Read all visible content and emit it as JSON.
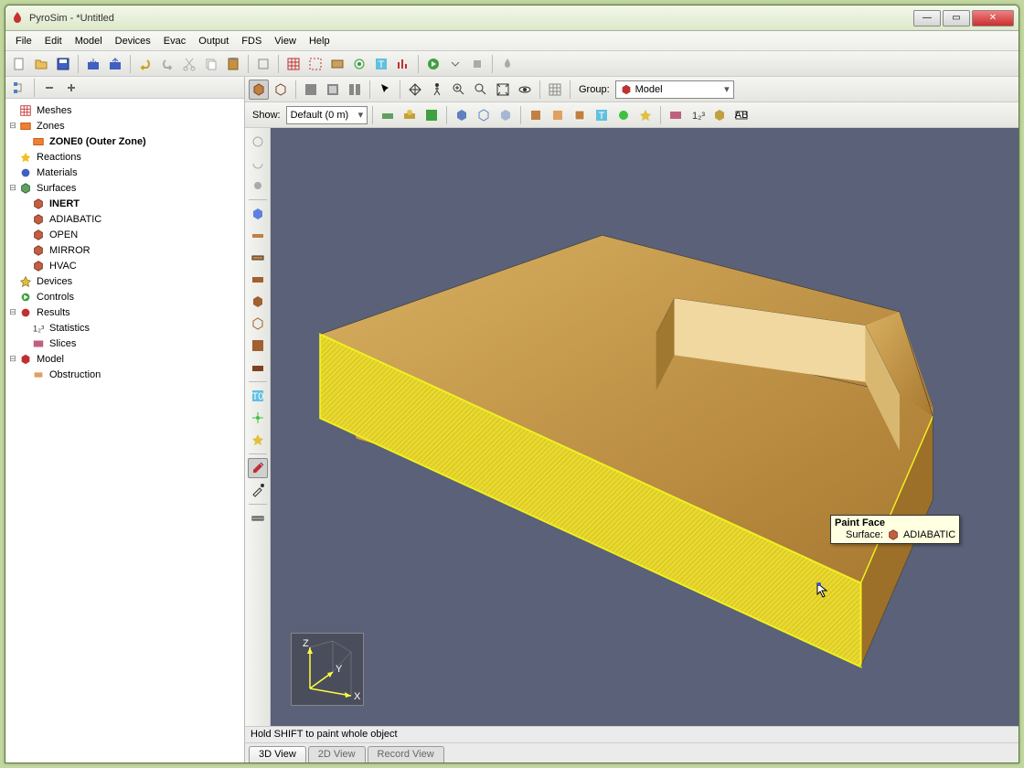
{
  "window": {
    "title": "PyroSim - *Untitled"
  },
  "menu": [
    "File",
    "Edit",
    "Model",
    "Devices",
    "Evac",
    "Output",
    "FDS",
    "View",
    "Help"
  ],
  "sidebar": {
    "items": [
      {
        "label": "Meshes",
        "icon": "mesh",
        "indent": 0,
        "bold": false,
        "toggle": ""
      },
      {
        "label": "Zones",
        "icon": "zone",
        "indent": 0,
        "bold": false,
        "toggle": "⊟"
      },
      {
        "label": "ZONE0 (Outer Zone)",
        "icon": "zone",
        "indent": 1,
        "bold": true,
        "toggle": ""
      },
      {
        "label": "Reactions",
        "icon": "reaction",
        "indent": 0,
        "bold": false,
        "toggle": ""
      },
      {
        "label": "Materials",
        "icon": "material",
        "indent": 0,
        "bold": false,
        "toggle": ""
      },
      {
        "label": "Surfaces",
        "icon": "surface",
        "indent": 0,
        "bold": false,
        "toggle": "⊟"
      },
      {
        "label": "INERT",
        "icon": "surf",
        "indent": 1,
        "bold": true,
        "toggle": ""
      },
      {
        "label": "ADIABATIC",
        "icon": "surf",
        "indent": 1,
        "bold": false,
        "toggle": ""
      },
      {
        "label": "OPEN",
        "icon": "surf",
        "indent": 1,
        "bold": false,
        "toggle": ""
      },
      {
        "label": "MIRROR",
        "icon": "surf",
        "indent": 1,
        "bold": false,
        "toggle": ""
      },
      {
        "label": "HVAC",
        "icon": "surf",
        "indent": 1,
        "bold": false,
        "toggle": ""
      },
      {
        "label": "Devices",
        "icon": "devices",
        "indent": 0,
        "bold": false,
        "toggle": ""
      },
      {
        "label": "Controls",
        "icon": "controls",
        "indent": 0,
        "bold": false,
        "toggle": ""
      },
      {
        "label": "Results",
        "icon": "results",
        "indent": 0,
        "bold": false,
        "toggle": "⊟"
      },
      {
        "label": "Statistics",
        "icon": "stats",
        "indent": 1,
        "bold": false,
        "toggle": ""
      },
      {
        "label": "Slices",
        "icon": "slices",
        "indent": 1,
        "bold": false,
        "toggle": ""
      },
      {
        "label": "Model",
        "icon": "model",
        "indent": 0,
        "bold": false,
        "toggle": "⊟"
      },
      {
        "label": "Obstruction",
        "icon": "obst",
        "indent": 1,
        "bold": false,
        "toggle": ""
      }
    ]
  },
  "viewToolbar": {
    "groupLabel": "Group:",
    "groupValue": "Model",
    "showLabel": "Show:",
    "showValue": "Default (0 m)"
  },
  "tooltip": {
    "title": "Paint Face",
    "surfaceLabel": "Surface:",
    "surfaceValue": "ADIABATIC"
  },
  "status": "Hold SHIFT to paint whole object",
  "tabs": [
    "3D View",
    "2D View",
    "Record View"
  ],
  "axes": {
    "x": "X",
    "y": "Y",
    "z": "Z"
  }
}
